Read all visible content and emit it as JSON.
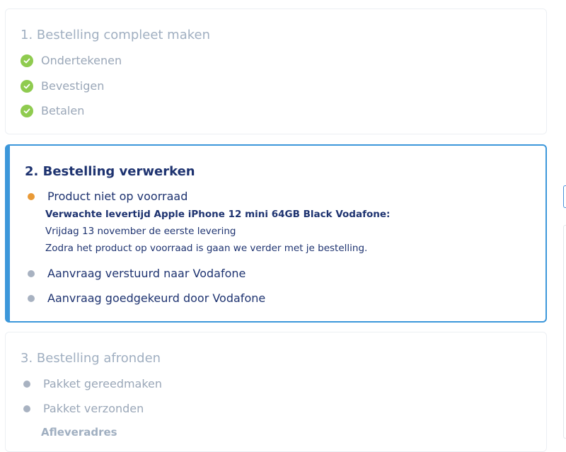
{
  "section1": {
    "title": "1. Bestelling compleet maken",
    "steps": [
      {
        "label": "Ondertekenen"
      },
      {
        "label": "Bevestigen"
      },
      {
        "label": "Betalen"
      }
    ]
  },
  "section2": {
    "title": "2. Bestelling verwerken",
    "steps": [
      {
        "label": "Product niet op voorraad",
        "status": "orange"
      },
      {
        "label": "Aanvraag verstuurd naar Vodafone",
        "status": "grey"
      },
      {
        "label": "Aanvraag goedgekeurd door Vodafone",
        "status": "grey"
      }
    ],
    "details": {
      "heading": "Verwachte levertijd Apple iPhone 12 mini 64GB Black Vodafone:",
      "line1": "Vrijdag 13 november de eerste levering",
      "line2": "Zodra het product op voorraad is gaan we verder met je bestelling."
    }
  },
  "section3": {
    "title": "3. Bestelling afronden",
    "steps": [
      {
        "label": "Pakket gereedmaken"
      },
      {
        "label": "Pakket verzonden"
      }
    ],
    "address_label": "Afleveradres"
  },
  "colors": {
    "accent": "#3c97da",
    "check": "#8fcb4f",
    "pending": "#e99a37",
    "inactive": "#a8b2c1",
    "title_dark": "#1e3370"
  }
}
